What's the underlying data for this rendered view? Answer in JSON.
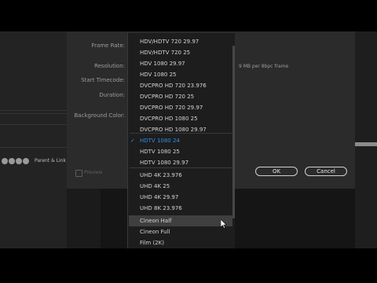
{
  "dialog": {
    "labels": {
      "frame_rate": "Frame Rate:",
      "resolution": "Resolution:",
      "start_timecode": "Start Timecode:",
      "duration": "Duration:",
      "background_color": "Background Color:"
    },
    "mbps_note": "9 MB per 8bpc frame",
    "preview_label": "Preview",
    "ok_label": "OK",
    "cancel_label": "Cancel"
  },
  "timeline": {
    "parent_link_label": "Parent & Link"
  },
  "dropdown": {
    "selected_index": 10,
    "hover_index": 18,
    "options": [
      "HDV/HDTV 720 29.97",
      "HDV/HDTV 720 25",
      "HDV 1080 29.97",
      "HDV 1080 25",
      "DVCPRO HD 720 23.976",
      "DVCPRO HD 720 25",
      "DVCPRO HD 720 29.97",
      "DVCPRO HD 1080 25",
      "DVCPRO HD 1080 29.97",
      "",
      "HDTV 1080 24",
      "HDTV 1080 25",
      "HDTV 1080 29.97",
      "",
      "UHD 4K 23.976",
      "UHD 4K 25",
      "UHD 4K 29.97",
      "UHD 8K 23.976",
      "Cineon Half",
      "Cineon Full",
      "Film (2K)"
    ]
  },
  "colors": {
    "accent_selected": "#2f8fe8",
    "menu_bg": "#1d1d1d",
    "dialog_bg": "#2b2b2b"
  },
  "icons": {
    "checkmark": "check-icon",
    "cursor": "mouse-pointer-icon"
  }
}
